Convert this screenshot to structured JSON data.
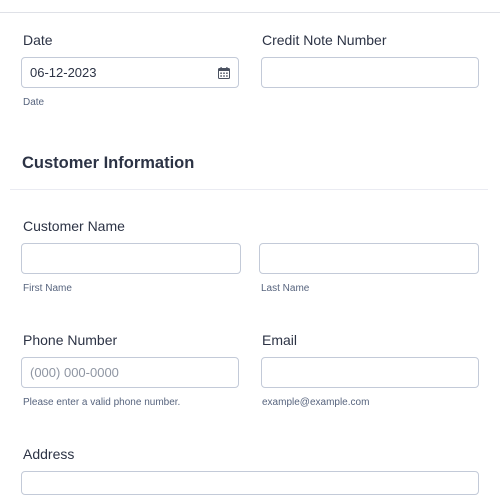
{
  "form": {
    "date": {
      "label": "Date",
      "value": "06-12-2023",
      "sublabel": "Date",
      "icon": "calendar-icon"
    },
    "credit_note": {
      "label": "Credit Note Number",
      "value": ""
    },
    "customer_section": {
      "title": "Customer Information"
    },
    "customer_name": {
      "label": "Customer Name",
      "first_sublabel": "First Name",
      "last_sublabel": "Last Name"
    },
    "phone": {
      "label": "Phone Number",
      "placeholder": "(000) 000-0000",
      "sublabel": "Please enter a valid phone number."
    },
    "email": {
      "label": "Email",
      "sublabel": "example@example.com"
    },
    "address": {
      "label": "Address"
    }
  },
  "colors": {
    "text": "#2c3345",
    "sublabel": "#57647e",
    "border": "#c3cad8",
    "placeholder": "#8f96a3"
  }
}
